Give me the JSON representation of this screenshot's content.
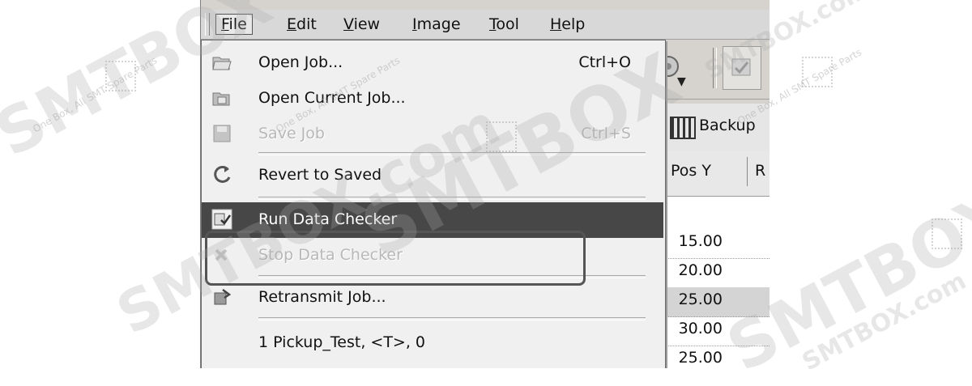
{
  "menubar": {
    "items": [
      {
        "label": "File",
        "mnemonic_index": 0
      },
      {
        "label": "Edit",
        "mnemonic_index": 0
      },
      {
        "label": "View",
        "mnemonic_index": 0
      },
      {
        "label": "Image",
        "mnemonic_index": 0
      },
      {
        "label": "Tool",
        "mnemonic_index": 0
      },
      {
        "label": "Help",
        "mnemonic_index": 0
      }
    ]
  },
  "file_menu": {
    "open_job": {
      "label": "Open Job...",
      "shortcut": "Ctrl+O"
    },
    "open_current_job": {
      "label": "Open Current Job..."
    },
    "save_job": {
      "label": "Save Job",
      "shortcut": "Ctrl+S"
    },
    "revert": {
      "label": "Revert to Saved"
    },
    "run_checker": {
      "label": "Run Data Checker"
    },
    "stop_checker": {
      "label": "Stop Data Checker"
    },
    "retransmit": {
      "label": "Retransmit Job..."
    },
    "recent_1": {
      "label": "1 Pickup_Test, <T>, 0"
    }
  },
  "tab": {
    "label": "Backup"
  },
  "table": {
    "headers": [
      "Pos Y",
      "R"
    ],
    "rows": [
      "15.00",
      "20.00",
      "25.00",
      "30.00",
      "25.00"
    ]
  },
  "watermark": {
    "text": "SMTBOX.com",
    "brand": "SMTBOX",
    "tagline": "One Box, All SMT Spare Parts"
  },
  "colors": {
    "highlight": "#474747",
    "menu_bg": "#f0f0f0",
    "disabled_text": "#b8b8b8"
  }
}
